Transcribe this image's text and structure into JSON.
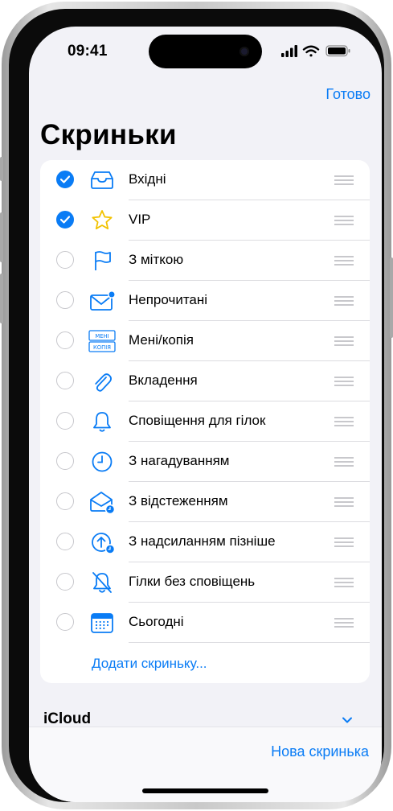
{
  "status_bar": {
    "time": "09:41"
  },
  "header": {
    "done_label": "Готово",
    "title": "Скриньки"
  },
  "mailboxes": [
    {
      "label": "Вхідні",
      "icon": "inbox-tray-icon",
      "checked": true
    },
    {
      "label": "VIP",
      "icon": "star-icon",
      "checked": true
    },
    {
      "label": "З міткою",
      "icon": "flag-icon",
      "checked": false
    },
    {
      "label": "Непрочитані",
      "icon": "unread-envelope-icon",
      "checked": false
    },
    {
      "label": "Мені/копія",
      "icon": "to-cc-icon",
      "checked": false,
      "icon_text": [
        "МЕНІ",
        "КОПІЯ"
      ]
    },
    {
      "label": "Вкладення",
      "icon": "paperclip-icon",
      "checked": false
    },
    {
      "label": "Сповіщення для гілок",
      "icon": "bell-icon",
      "checked": false
    },
    {
      "label": "З нагадуванням",
      "icon": "clock-icon",
      "checked": false
    },
    {
      "label": "З відстеженням",
      "icon": "follow-up-envelope-icon",
      "checked": false
    },
    {
      "label": "З надсиланням пізніше",
      "icon": "send-later-icon",
      "checked": false
    },
    {
      "label": "Гілки без сповіщень",
      "icon": "bell-slash-icon",
      "checked": false
    },
    {
      "label": "Сьогодні",
      "icon": "calendar-icon",
      "checked": false
    }
  ],
  "add_mailbox_label": "Додати скриньку...",
  "account_section": {
    "title": "iCloud"
  },
  "toolbar": {
    "new_mailbox_label": "Нова скринька"
  },
  "colors": {
    "accent": "#0a7cf5",
    "background": "#f2f2f7",
    "star": "#f2c200"
  }
}
